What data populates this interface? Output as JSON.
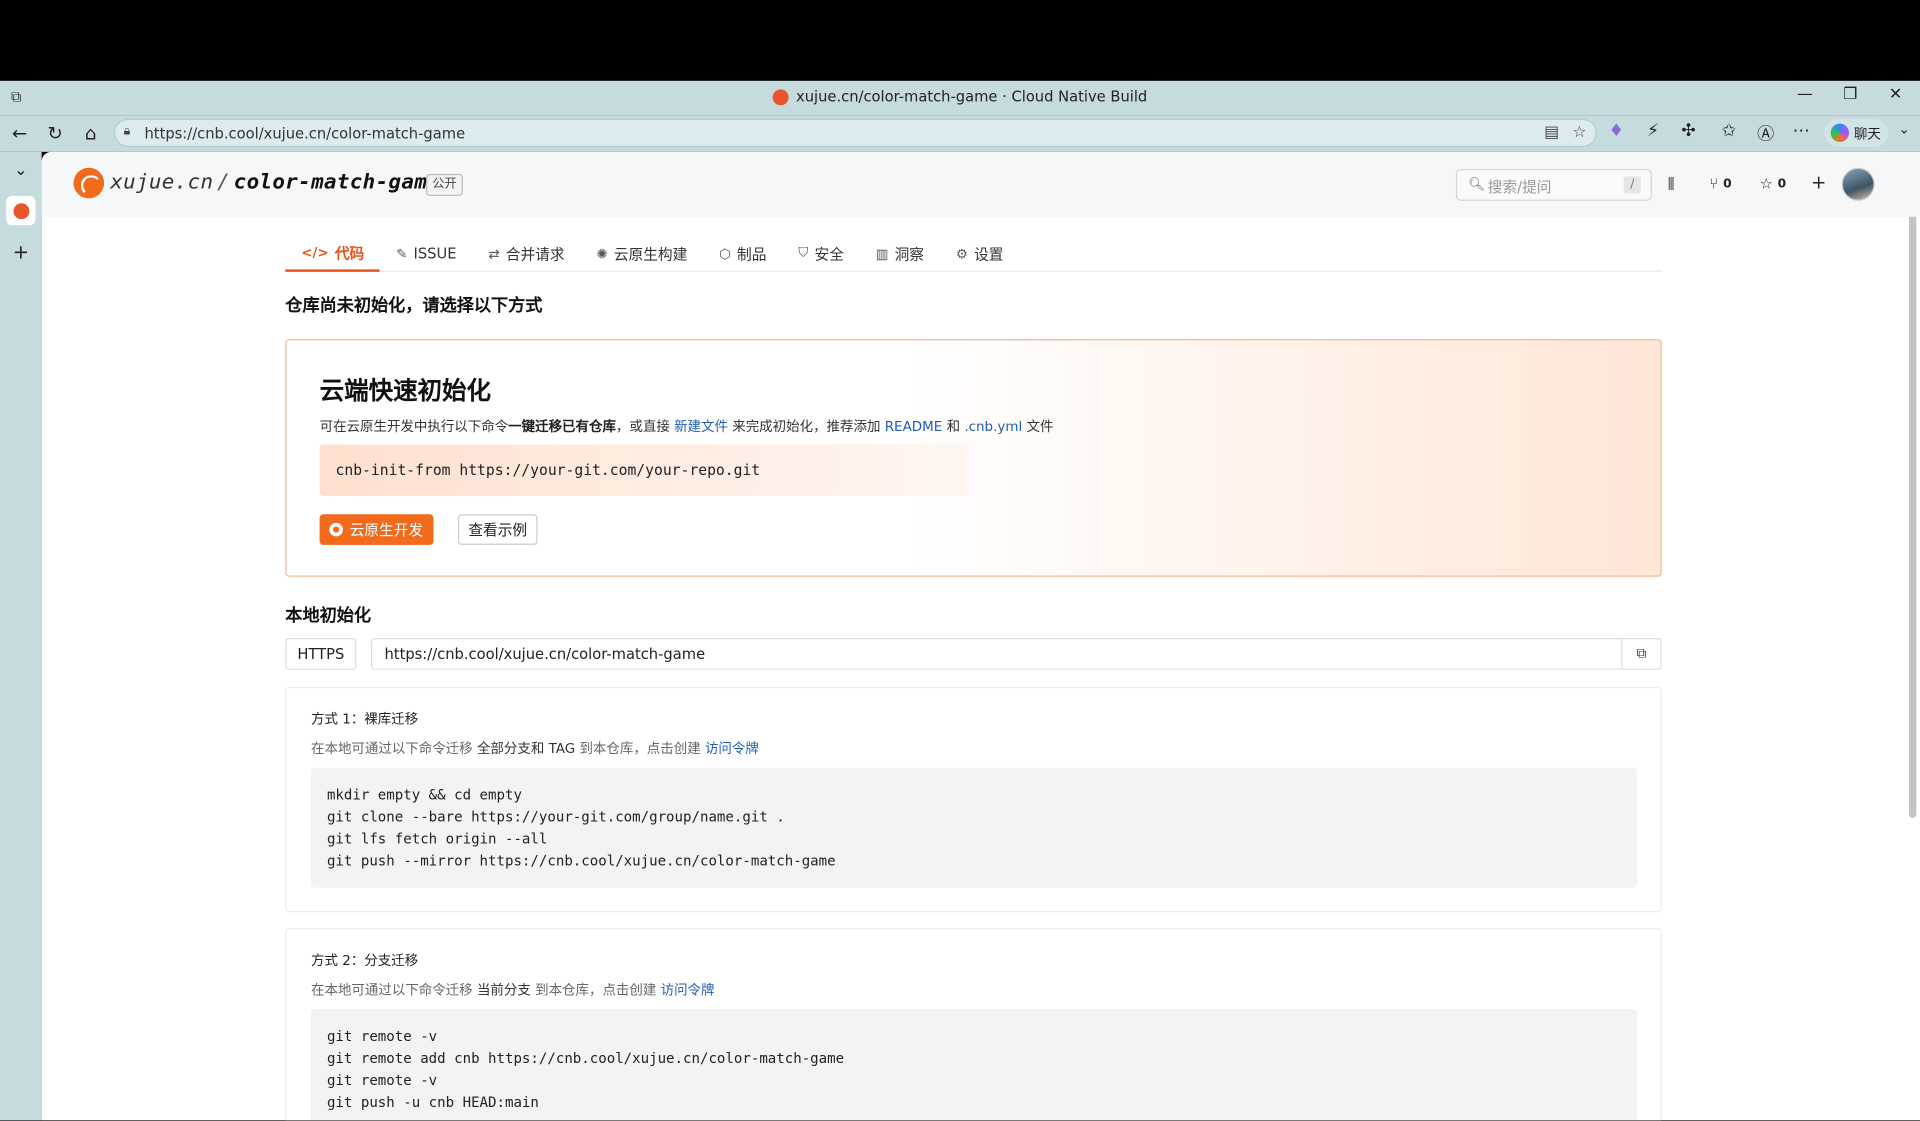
{
  "browser": {
    "window_title": "xujue.cn/color-match-game · Cloud Native Build",
    "url": "https://cnb.cool/xujue.cn/color-match-game",
    "chat_label": "聊天"
  },
  "repo": {
    "owner": "xujue.cn",
    "separator": "/",
    "name": "color-match-game",
    "visibility": "公开"
  },
  "header": {
    "search_placeholder": "搜索/提问",
    "search_shortcut": "/",
    "fork_count": "0",
    "star_count": "0"
  },
  "tabs": [
    {
      "label": "代码",
      "icon": "code-icon",
      "active": true
    },
    {
      "label": "ISSUE",
      "icon": "issue-icon",
      "active": false
    },
    {
      "label": "合并请求",
      "icon": "pull-request-icon",
      "active": false
    },
    {
      "label": "云原生构建",
      "icon": "build-icon",
      "active": false
    },
    {
      "label": "制品",
      "icon": "package-icon",
      "active": false
    },
    {
      "label": "安全",
      "icon": "shield-icon",
      "active": false
    },
    {
      "label": "洞察",
      "icon": "chart-icon",
      "active": false
    },
    {
      "label": "设置",
      "icon": "gear-icon",
      "active": false
    }
  ],
  "notice": "仓库尚未初始化，请选择以下方式",
  "cloud_init": {
    "title": "云端快速初始化",
    "desc_1": "可在云原生开发中执行以下命令",
    "desc_strong": "一键迁移已有仓库",
    "desc_2": "，或直接 ",
    "link_new_file": "新建文件",
    "desc_3": " 来完成初始化，推荐添加 ",
    "link_readme": "README",
    "desc_4": " 和 ",
    "link_cnb": ".cnb.yml",
    "desc_5": " 文件",
    "command": "cnb-init-from https://your-git.com/your-repo.git",
    "primary_button": "云原生开发",
    "secondary_button": "查看示例"
  },
  "local_init": {
    "title": "本地初始化",
    "protocol": "HTTPS",
    "clone_url": "https://cnb.cool/xujue.cn/color-match-game"
  },
  "methods": [
    {
      "title": "方式 1：裸库迁移",
      "desc_1": "在本地可通过以下命令迁移 ",
      "desc_strong": "全部分支和 TAG",
      "desc_2": " 到本仓库，点击创建 ",
      "link": "访问令牌",
      "code": [
        "mkdir empty && cd empty",
        "git clone --bare https://your-git.com/group/name.git .",
        "git lfs fetch origin --all",
        "git push --mirror https://cnb.cool/xujue.cn/color-match-game"
      ]
    },
    {
      "title": "方式 2：分支迁移",
      "desc_1": "在本地可通过以下命令迁移 ",
      "desc_strong": "当前分支",
      "desc_2": " 到本仓库，点击创建 ",
      "link": "访问令牌",
      "code": [
        "git remote -v",
        "git remote add cnb https://cnb.cool/xujue.cn/color-match-game",
        "git remote -v",
        "git push -u cnb HEAD:main"
      ]
    }
  ]
}
